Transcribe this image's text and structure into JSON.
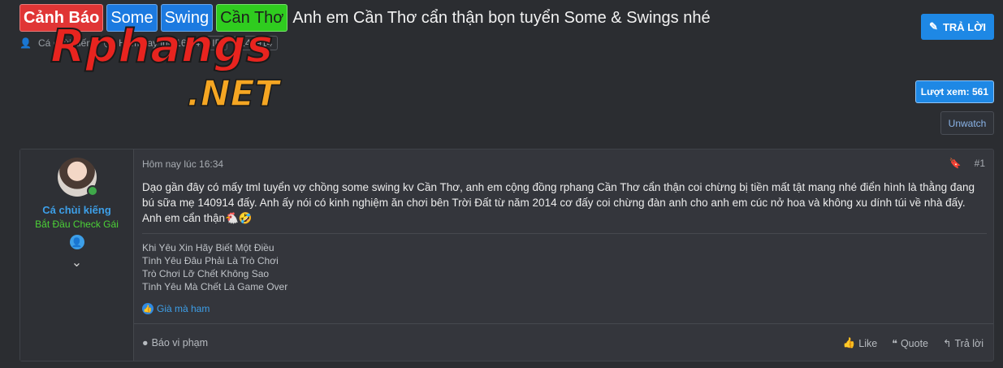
{
  "thread": {
    "tags": [
      "Cảnh Báo",
      "Some",
      "Swing",
      "Cần Thơ"
    ],
    "title": "Anh em Cần Thơ cẩn thận bọn tuyển Some & Swings nhé",
    "meta_author": "Cá chùi kiếng",
    "meta_time": "Hôm nay lúc 16:34",
    "meta_chip_1": "ID",
    "meta_chip_2": "140914"
  },
  "logo": {
    "text_main": "Rphangs",
    "text_sub": ".NET"
  },
  "actions": {
    "reply_label": "TRẢ LỜI",
    "views_label": "Lượt xem: 561",
    "unwatch_label": "Unwatch"
  },
  "post": {
    "username": "Cá chùi kiếng",
    "user_title": "Bắt Đầu Check Gái",
    "date": "Hôm nay lúc 16:34",
    "number": "#1",
    "body": "Dạo gần đây có mấy tml tuyển vợ chồng some swing kv Cần Thơ, anh em cộng đồng rphang Cần Thơ cẩn thận coi chừng bị tiền mất tật mang nhé điển hình là thằng đang bú sữa mẹ 140914 đấy. Anh ấy nói có kinh nghiệm ăn chơi bên Trời Đất từ năm 2014 cơ đấy coi chừng đàn anh cho anh em cúc nở hoa và không xu dính túi về nhà đấy. Anh em cẩn thận🐔🤣",
    "signature": [
      "Khi Yêu Xin Hãy Biết Một Điều",
      "Tình Yêu Đâu Phải Là Trò Chơi",
      "Trò Chơi Lỡ Chết Không Sao",
      "Tình Yêu Mà Chết Là Game Over"
    ],
    "liked_by": "Già mà ham",
    "report_label": "Báo vi phạm",
    "like_label": "Like",
    "quote_label": "Quote",
    "reply_label": "Trả lời"
  },
  "colors": {
    "background": "#2b2d31",
    "accent": "#1e88e5",
    "tag_red": "#e03535",
    "tag_green": "#2fcc1f",
    "username": "#3d9fe8",
    "user_title": "#4cd137"
  }
}
